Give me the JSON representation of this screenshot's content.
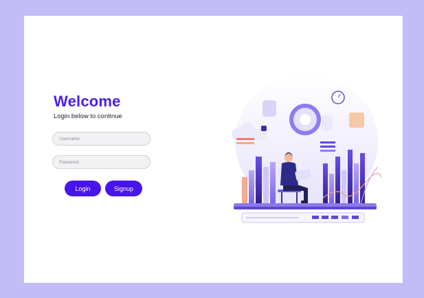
{
  "welcome": {
    "title": "Welcome",
    "subtitle": "Login below to continue"
  },
  "form": {
    "username_placeholder": "Username",
    "username_value": "",
    "password_placeholder": "Password",
    "password_value": "",
    "login_label": "Login",
    "signup_label": "Signup"
  },
  "colors": {
    "page_background": "#c2bdf7",
    "card_background": "#ffffff",
    "accent": "#4715ea",
    "title": "#4a1cf2"
  },
  "illustration": {
    "name": "analytics-dashboard-illustration",
    "subject": "man-with-laptop-icon"
  }
}
